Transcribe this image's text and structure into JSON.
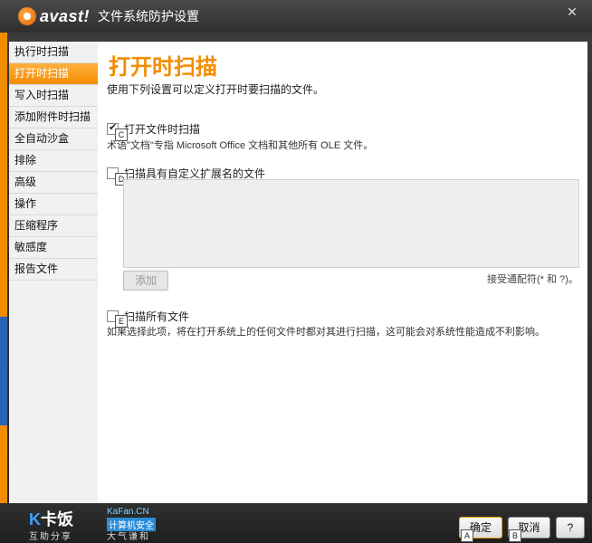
{
  "window": {
    "logo_text": "avast!",
    "title": "文件系统防护设置",
    "close_glyph": "✕"
  },
  "sidebar": {
    "items": [
      {
        "label": "执行时扫描",
        "active": false
      },
      {
        "label": "打开时扫描",
        "active": true
      },
      {
        "label": "写入时扫描",
        "active": false
      },
      {
        "label": "添加附件时扫描",
        "active": false
      },
      {
        "label": "全自动沙盒",
        "active": false
      },
      {
        "label": "排除",
        "active": false
      },
      {
        "label": "高级",
        "active": false
      },
      {
        "label": "操作",
        "active": false
      },
      {
        "label": "压缩程序",
        "active": false
      },
      {
        "label": "敏感度",
        "active": false
      },
      {
        "label": "报告文件",
        "active": false
      }
    ]
  },
  "main": {
    "title": "打开时扫描",
    "description": "使用下列设置可以定义打开时要扫描的文件。",
    "option_documents": {
      "label": "打开文件时扫描",
      "checked": true,
      "key": "C",
      "note": "术语\"文档\"专指 Microsoft Office 文档和其他所有 OLE 文件。"
    },
    "option_extensions": {
      "label": "扫描具有自定义扩展名的文件",
      "checked": false,
      "key": "D",
      "add_button": "添加",
      "wildcard_note": "接受通配符(* 和 ?)。"
    },
    "option_all": {
      "label": "扫描所有文件",
      "checked": false,
      "key": "E",
      "note": "如果选择此项，将在打开系统上的任何文件时都对其进行扫描，这可能会对系统性能造成不利影响。"
    }
  },
  "footer": {
    "brand_main": "卡饭",
    "brand_k": "K",
    "brand_url": "KaFan.CN",
    "brand_slogan1": "计算机安全",
    "brand_slogan2": "互助分享",
    "brand_slogan3": "大气谦和",
    "ok_label": "确定",
    "ok_key": "A",
    "cancel_label": "取消",
    "cancel_key": "B",
    "help_label": "?"
  },
  "colors": {
    "accent": "#f28c00",
    "title_bar": "#2f2f2f"
  }
}
